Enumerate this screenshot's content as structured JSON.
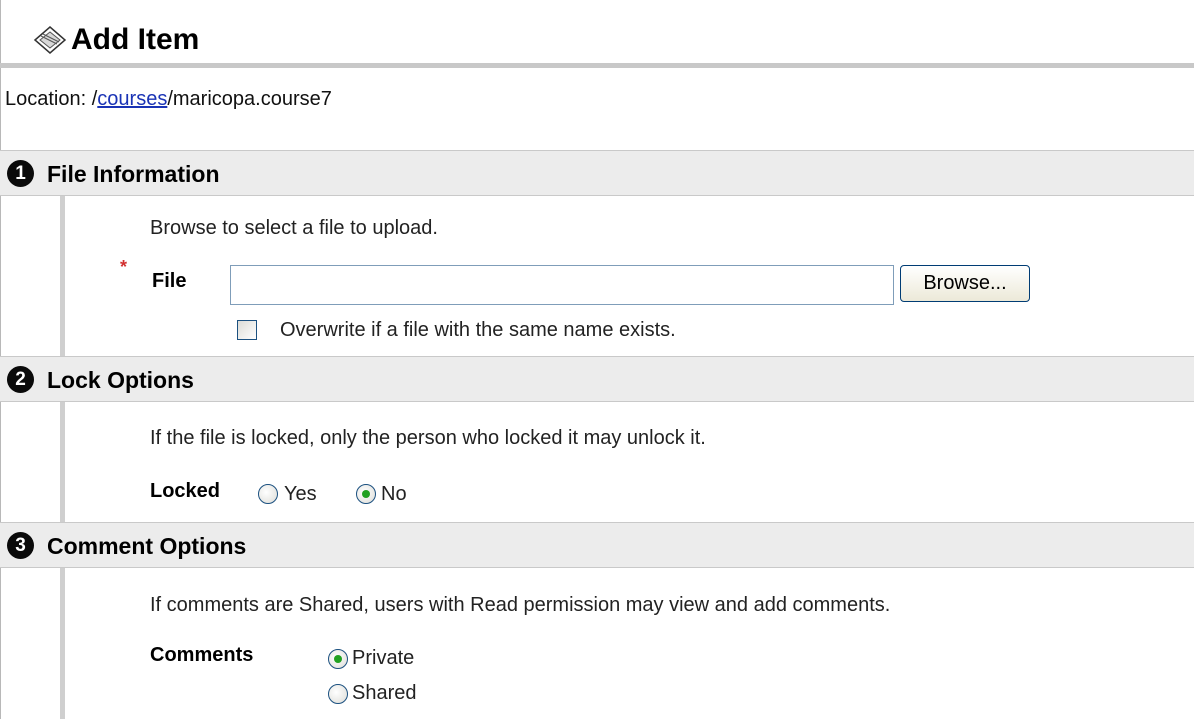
{
  "header": {
    "title": "Add Item",
    "icon": "add-item-icon"
  },
  "location": {
    "prefix": "Location: /",
    "link": "courses",
    "suffix": "/maricopa.course7"
  },
  "sections": [
    {
      "number": "1",
      "title": "File Information",
      "instruction": "Browse to select a file to upload.",
      "required_marker": "*",
      "file_label": "File",
      "file_value": "",
      "browse_label": "Browse...",
      "overwrite_label": "Overwrite if a file with the same name exists.",
      "overwrite_checked": false
    },
    {
      "number": "2",
      "title": "Lock Options",
      "instruction": "If the file is locked, only the person who locked it may unlock it.",
      "locked_label": "Locked",
      "options": [
        {
          "label": "Yes",
          "selected": false
        },
        {
          "label": "No",
          "selected": true
        }
      ]
    },
    {
      "number": "3",
      "title": "Comment Options",
      "instruction": "If comments are Shared, users with Read permission may view and add comments.",
      "comments_label": "Comments",
      "options": [
        {
          "label": "Private",
          "selected": true
        },
        {
          "label": "Shared",
          "selected": false
        }
      ]
    }
  ],
  "colors": {
    "accent": "#21a121",
    "link": "#1a33b5",
    "required": "#d23030",
    "section_bg": "#ececec"
  }
}
